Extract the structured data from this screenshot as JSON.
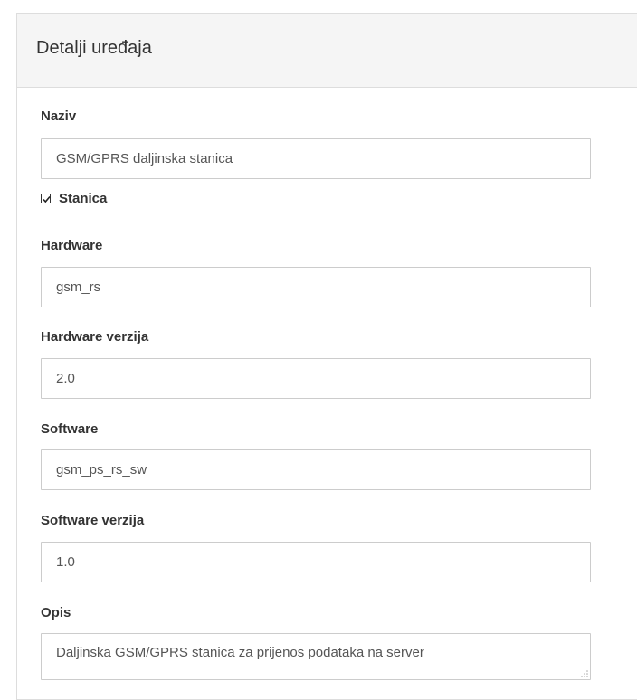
{
  "panel": {
    "title": "Detalji uređaja"
  },
  "fields": {
    "naziv": {
      "label": "Naziv",
      "value": "GSM/GPRS daljinska stanica"
    },
    "stanica": {
      "label": "Stanica",
      "checked": true
    },
    "hardware": {
      "label": "Hardware",
      "value": "gsm_rs"
    },
    "hardware_verzija": {
      "label": "Hardware verzija",
      "value": "2.0"
    },
    "software": {
      "label": "Software",
      "value": "gsm_ps_rs_sw"
    },
    "software_verzija": {
      "label": "Software verzija",
      "value": "1.0"
    },
    "opis": {
      "label": "Opis",
      "value": "Daljinska GSM/GPRS stanica za prijenos podataka na server"
    }
  }
}
